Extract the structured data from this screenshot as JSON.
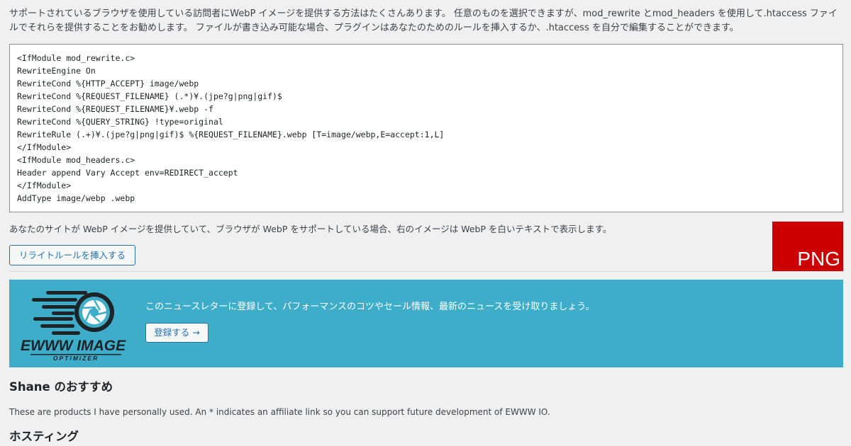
{
  "intro": {
    "text": "サポートされているブラウザを使用している訪問者にWebP イメージを提供する方法はたくさんあります。 任意のものを選択できますが、mod_rewrite とmod_headers を使用して.htaccess ファイルでそれらを提供することをお勧めします。 ファイルが書き込み可能な場合、プラグインはあなたのためのルールを挿入するか、.htaccess を自分で編集することができます。"
  },
  "code": {
    "lines": [
      "<IfModule mod_rewrite.c>",
      "RewriteEngine On",
      "RewriteCond %{HTTP_ACCEPT} image/webp",
      "RewriteCond %{REQUEST_FILENAME} (.*)¥.(jpe?g|png|gif)$",
      "RewriteCond %{REQUEST_FILENAME}¥.webp -f",
      "RewriteCond %{QUERY_STRING} !type=original",
      "RewriteRule (.+)¥.(jpe?g|png|gif)$ %{REQUEST_FILENAME}.webp [T=image/webp,E=accept:1,L]",
      "</IfModule>",
      "<IfModule mod_headers.c>",
      "Header append Vary Accept env=REDIRECT_accept",
      "</IfModule>",
      "AddType image/webp .webp"
    ]
  },
  "webp_test": {
    "note": "あなたのサイトが WebP イメージを提供していて、ブラウザが WebP をサポートしている場合、右のイメージは WebP を白いテキストで表示します。",
    "button_label": "リライトルールを挿入する",
    "image_label": "PNG",
    "image_color": "#cc0000"
  },
  "newsletter": {
    "background_color": "#3eadc9",
    "logo_icon": "ewww-aperture-logo-icon",
    "logo_word": "EWWW IMAGE",
    "logo_sub": "OPTIMIZER",
    "text": "このニュースレターに登録して、パフォーマンスのコツやセール情報、最新のニュースを受け取りましょう。",
    "button_label": "登録する →"
  },
  "recommendations": {
    "title": "Shane のおすすめ",
    "description": "These are products I have personally used. An * indicates an affiliate link so you can support future development of EWWW IO.",
    "hosting_title": "ホスティング"
  }
}
